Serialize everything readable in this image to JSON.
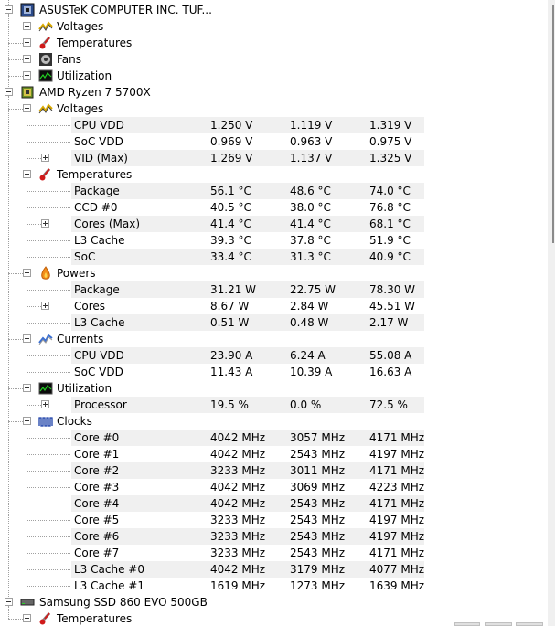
{
  "tree": [
    {
      "id": "asus",
      "level": 0,
      "label": "ASUSTeK COMPUTER INC. TUF...",
      "icon": "motherboard-icon",
      "expander": "minus"
    },
    {
      "id": "asus-voltages",
      "level": 1,
      "label": "Voltages",
      "icon": "voltage-icon",
      "expander": "plus"
    },
    {
      "id": "asus-temps",
      "level": 1,
      "label": "Temperatures",
      "icon": "thermometer-icon",
      "expander": "plus"
    },
    {
      "id": "asus-fans",
      "level": 1,
      "label": "Fans",
      "icon": "fan-icon",
      "expander": "plus"
    },
    {
      "id": "asus-util",
      "level": 1,
      "label": "Utilization",
      "icon": "utilization-icon",
      "expander": "plus"
    },
    {
      "id": "cpu",
      "level": 0,
      "label": "AMD Ryzen 7 5700X",
      "icon": "cpu-chip-icon",
      "expander": "minus"
    },
    {
      "id": "cpu-voltages",
      "level": 1,
      "label": "Voltages",
      "icon": "voltage-icon",
      "expander": "minus"
    },
    {
      "id": "cpu-vdd-v",
      "level": 2,
      "label": "CPU VDD",
      "values": [
        "1.250 V",
        "1.119 V",
        "1.319 V"
      ]
    },
    {
      "id": "soc-vdd-v",
      "level": 2,
      "label": "SoC VDD",
      "values": [
        "0.969 V",
        "0.963 V",
        "0.975 V"
      ]
    },
    {
      "id": "vid-max",
      "level": 2,
      "label": "VID (Max)",
      "expander": "plus",
      "values": [
        "1.269 V",
        "1.137 V",
        "1.325 V"
      ]
    },
    {
      "id": "cpu-temps",
      "level": 1,
      "label": "Temperatures",
      "icon": "thermometer-icon",
      "expander": "minus"
    },
    {
      "id": "pkg-temp",
      "level": 2,
      "label": "Package",
      "values": [
        "56.1 °C",
        "48.6 °C",
        "74.0 °C"
      ]
    },
    {
      "id": "ccd0",
      "level": 2,
      "label": "CCD #0",
      "values": [
        "40.5 °C",
        "38.0 °C",
        "76.8 °C"
      ]
    },
    {
      "id": "cores-max",
      "level": 2,
      "label": "Cores (Max)",
      "expander": "plus",
      "values": [
        "41.4 °C",
        "41.4 °C",
        "68.1 °C"
      ]
    },
    {
      "id": "l3-temp",
      "level": 2,
      "label": "L3 Cache",
      "values": [
        "39.3 °C",
        "37.8 °C",
        "51.9 °C"
      ]
    },
    {
      "id": "soc-temp",
      "level": 2,
      "label": "SoC",
      "values": [
        "33.4 °C",
        "31.3 °C",
        "40.9 °C"
      ]
    },
    {
      "id": "cpu-powers",
      "level": 1,
      "label": "Powers",
      "icon": "power-icon",
      "expander": "minus"
    },
    {
      "id": "pkg-power",
      "level": 2,
      "label": "Package",
      "values": [
        "31.21 W",
        "22.75 W",
        "78.30 W"
      ]
    },
    {
      "id": "cores-power",
      "level": 2,
      "label": "Cores",
      "expander": "plus",
      "values": [
        "8.67 W",
        "2.84 W",
        "45.51 W"
      ]
    },
    {
      "id": "l3-power",
      "level": 2,
      "label": "L3 Cache",
      "values": [
        "0.51 W",
        "0.48 W",
        "2.17 W"
      ]
    },
    {
      "id": "cpu-currents",
      "level": 1,
      "label": "Currents",
      "icon": "current-icon",
      "expander": "minus"
    },
    {
      "id": "cpu-vdd-a",
      "level": 2,
      "label": "CPU VDD",
      "values": [
        "23.90 A",
        "6.24 A",
        "55.08 A"
      ]
    },
    {
      "id": "soc-vdd-a",
      "level": 2,
      "label": "SoC VDD",
      "values": [
        "11.43 A",
        "10.39 A",
        "16.63 A"
      ]
    },
    {
      "id": "cpu-util",
      "level": 1,
      "label": "Utilization",
      "icon": "utilization-icon",
      "expander": "minus"
    },
    {
      "id": "processor",
      "level": 2,
      "label": "Processor",
      "expander": "plus",
      "values": [
        "19.5 %",
        "0.0 %",
        "72.5 %"
      ]
    },
    {
      "id": "cpu-clocks",
      "level": 1,
      "label": "Clocks",
      "icon": "clock-icon",
      "expander": "minus"
    },
    {
      "id": "core0",
      "level": 2,
      "label": "Core #0",
      "values": [
        "4042 MHz",
        "3057 MHz",
        "4171 MHz"
      ]
    },
    {
      "id": "core1",
      "level": 2,
      "label": "Core #1",
      "values": [
        "4042 MHz",
        "2543 MHz",
        "4197 MHz"
      ]
    },
    {
      "id": "core2",
      "level": 2,
      "label": "Core #2",
      "values": [
        "3233 MHz",
        "3011 MHz",
        "4171 MHz"
      ]
    },
    {
      "id": "core3",
      "level": 2,
      "label": "Core #3",
      "values": [
        "4042 MHz",
        "3069 MHz",
        "4223 MHz"
      ]
    },
    {
      "id": "core4",
      "level": 2,
      "label": "Core #4",
      "values": [
        "4042 MHz",
        "2543 MHz",
        "4171 MHz"
      ]
    },
    {
      "id": "core5",
      "level": 2,
      "label": "Core #5",
      "values": [
        "3233 MHz",
        "2543 MHz",
        "4197 MHz"
      ]
    },
    {
      "id": "core6",
      "level": 2,
      "label": "Core #6",
      "values": [
        "3233 MHz",
        "2543 MHz",
        "4197 MHz"
      ]
    },
    {
      "id": "core7",
      "level": 2,
      "label": "Core #7",
      "values": [
        "3233 MHz",
        "2543 MHz",
        "4171 MHz"
      ]
    },
    {
      "id": "l3-cache0",
      "level": 2,
      "label": "L3 Cache #0",
      "values": [
        "4042 MHz",
        "3179 MHz",
        "4077 MHz"
      ]
    },
    {
      "id": "l3-cache1",
      "level": 2,
      "label": "L3 Cache #1",
      "values": [
        "1619 MHz",
        "1273 MHz",
        "1639 MHz"
      ]
    },
    {
      "id": "ssd",
      "level": 0,
      "label": "Samsung SSD 860 EVO 500GB",
      "icon": "drive-icon",
      "expander": "minus"
    },
    {
      "id": "ssd-temps",
      "level": 1,
      "label": "Temperatures",
      "icon": "thermometer-icon",
      "expander": "minus"
    }
  ],
  "colors": {
    "band": "#f0f0f0",
    "tree_line": "#a0a0a0",
    "scroll_thumb": "#8a8a8a"
  }
}
